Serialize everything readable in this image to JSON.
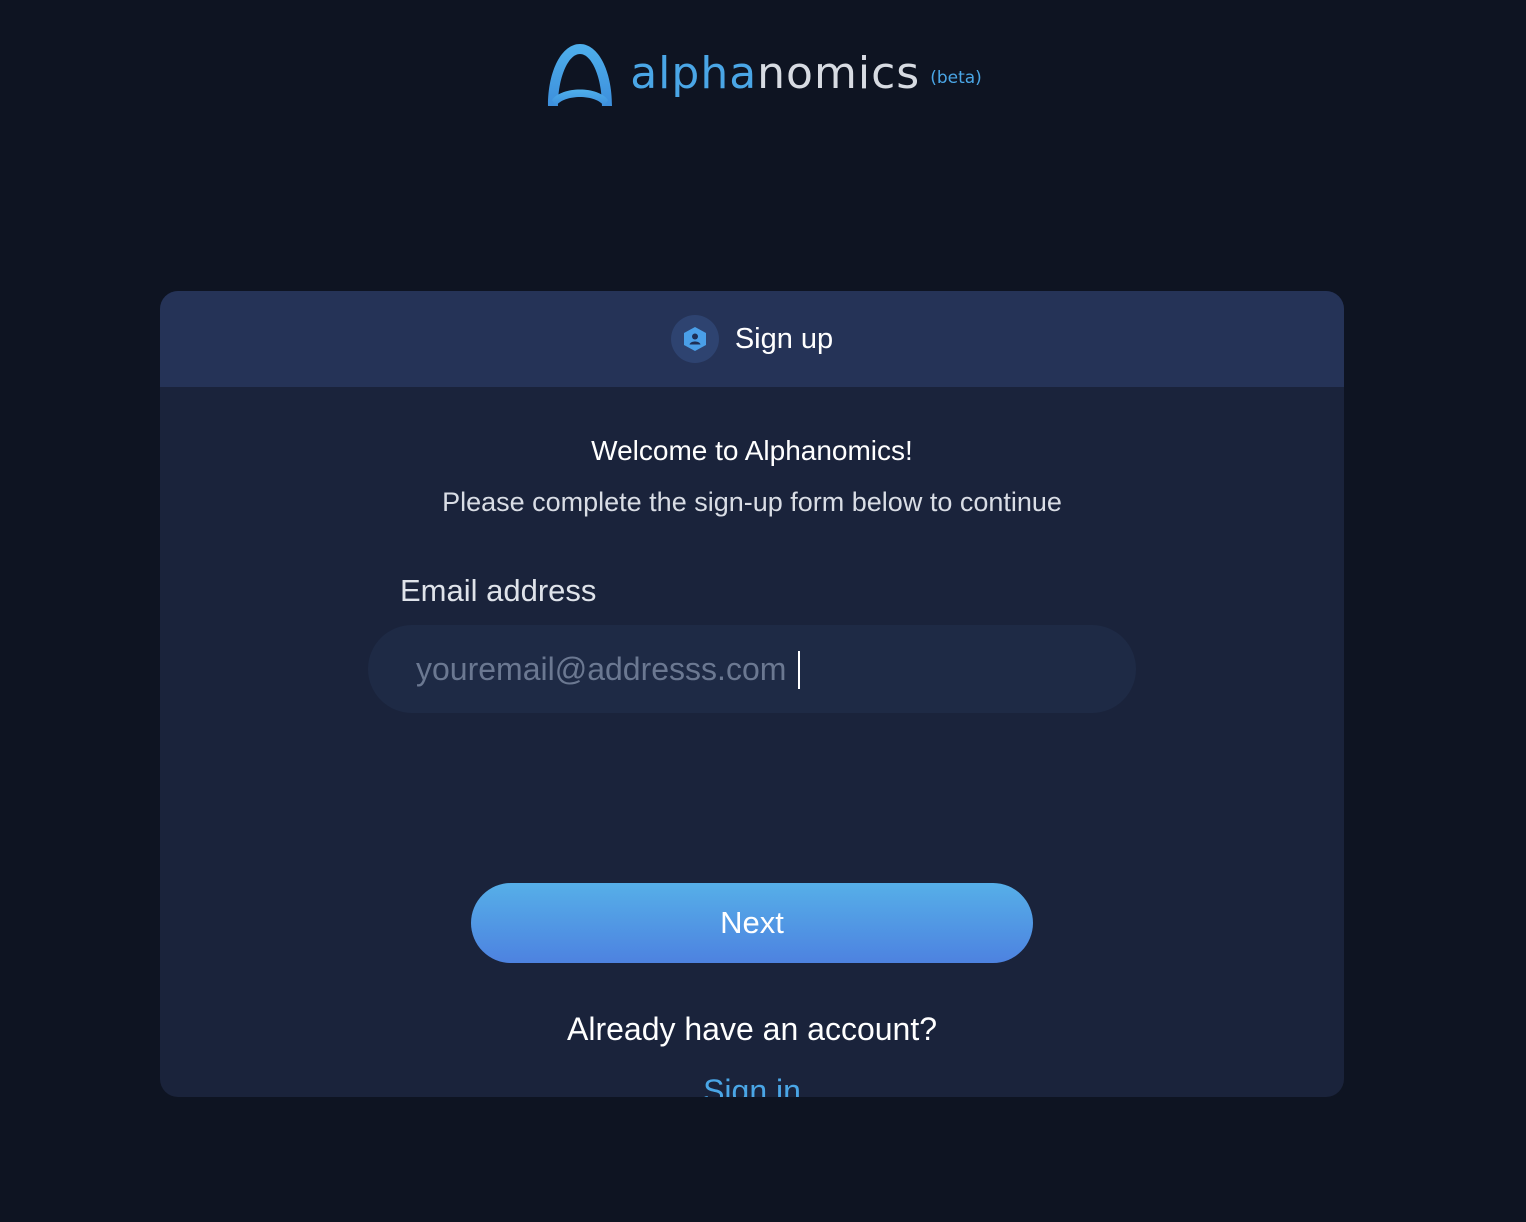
{
  "logo": {
    "word_part1": "alpha",
    "word_part2": "nomics",
    "beta": "(beta)",
    "icon": "alphanomics-arch-logo-icon"
  },
  "card": {
    "header_title": "Sign up",
    "header_icon": "user-hexagon-icon",
    "welcome": "Welcome to Alphanomics!",
    "subtitle": "Please complete the sign-up form below to continue",
    "email_label": "Email address",
    "email_placeholder": "youremail@addresss.com",
    "email_value": "",
    "next_label": "Next",
    "already_text": "Already have an account?",
    "signin_label": "Sign in"
  },
  "colors": {
    "background": "#0e1422",
    "card": "#1a233b",
    "card_header": "#253357",
    "accent": "#4aa6e6",
    "button_gradient_top": "#56afe8",
    "button_gradient_bottom": "#4d82e0"
  }
}
